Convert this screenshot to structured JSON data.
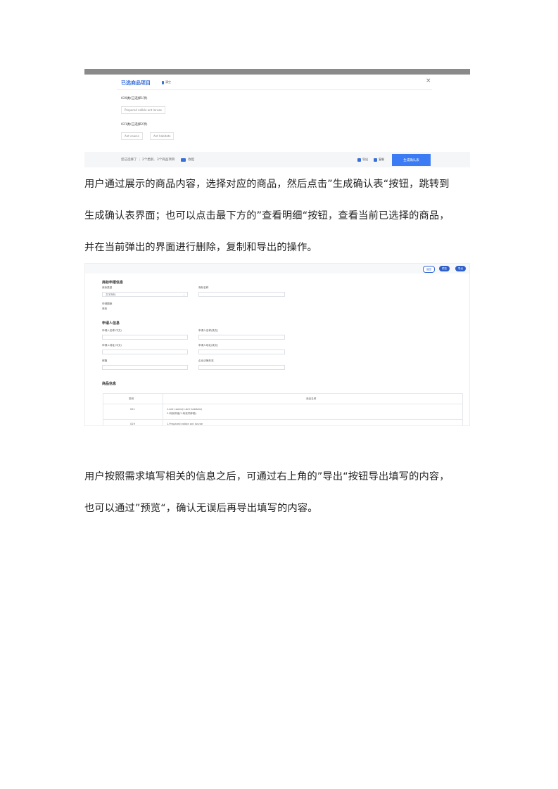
{
  "shot1": {
    "title": "已选商品项目",
    "clear_label": "清空",
    "close": "×",
    "groups": [
      {
        "title": "029类(已选择1项)",
        "tags": [
          "Prepared edible ant larvae"
        ]
      },
      {
        "title": "021类(已选择2项)",
        "tags": [
          "Ant cowns",
          "Ant habitats"
        ]
      }
    ],
    "summary": {
      "prefix": "您已选择了",
      "classes": "2个类别,",
      "items": "3个商品项目",
      "collapse": "收起"
    },
    "actions": {
      "export": "导出",
      "copy": "复制",
      "generate": "生成确认表"
    },
    "accent": "#3b7cf5"
  },
  "paragraph1": {
    "lines": [
      "用户通过展示的商品内容，选择对应的商品，然后点击”生成确认表“按钮，跳转到",
      "生成确认表界面；也可以点击最下方的”查看明细“按钮，查看当前已选择的商品，",
      "并在当前弹出的界面进行删除，复制和导出的操作。"
    ]
  },
  "shot2": {
    "buttons": {
      "back": "返回",
      "preview": "预览",
      "export": "导出"
    },
    "section1": {
      "title": "商标申报信息",
      "type_label": "商标类型",
      "type_value": "文字商标",
      "name_label": "商标名称",
      "desc_label": "申请图案",
      "desc_value": "商标"
    },
    "section2": {
      "title": "申请人信息",
      "f1": "申请人名称(中文)",
      "f2": "申请人名称(英文)",
      "f3": "申请人地址(中文)",
      "f4": "申请人地址(英文)",
      "f5": "邮箱",
      "f6": "企业法律形态"
    },
    "section3": {
      "title": "商品信息",
      "headers": [
        "类别",
        "商品名称"
      ],
      "rows": [
        {
          "cls": "021",
          "lines": [
            "1.Ant cowns(1.Ant habitats)",
            "2.蚂蚁养殖(2.蚂蚁饲养箱)"
          ]
        },
        {
          "cls": "029",
          "lines": [
            "1.Prepared edible ant larvae"
          ]
        }
      ]
    }
  },
  "paragraph2": {
    "lines": [
      "用户按照需求填写相关的信息之后，可通过右上角的”导出“按钮导出填写的内容，",
      "也可以通过”预览“，确认无误后再导出填写的内容。"
    ]
  }
}
